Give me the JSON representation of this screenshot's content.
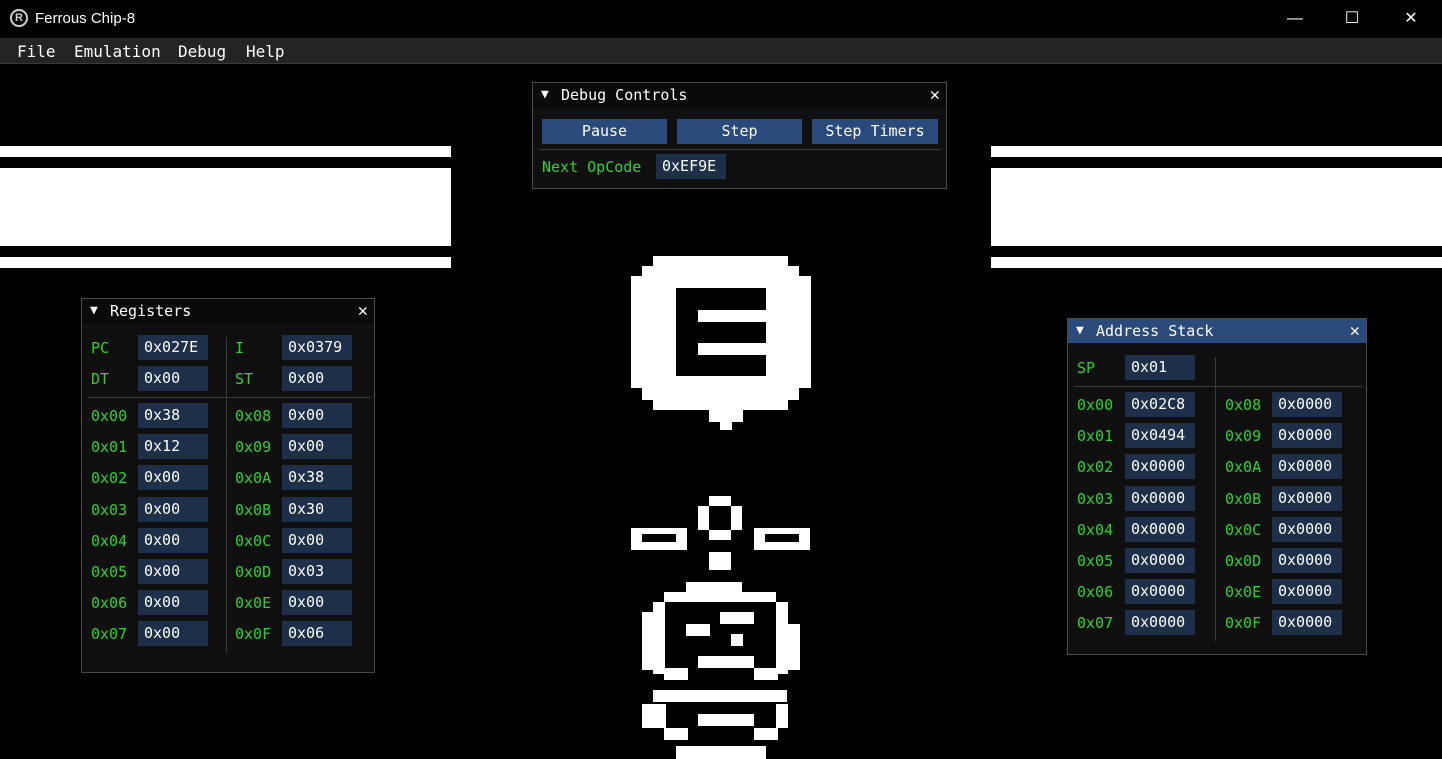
{
  "window": {
    "title": "Ferrous Chip-8",
    "minimize": "—",
    "maximize": "☐",
    "close": "✕"
  },
  "menu": [
    "File",
    "Emulation",
    "Debug",
    "Help"
  ],
  "debug_controls": {
    "title": "Debug Controls",
    "buttons": [
      "Pause",
      "Step",
      "Step Timers"
    ],
    "next_opcode_label": "Next OpCode",
    "next_opcode": "0xEF9E"
  },
  "registers": {
    "title": "Registers",
    "special": [
      {
        "label": "PC",
        "value": "0x027E"
      },
      {
        "label": "I",
        "value": "0x0379"
      },
      {
        "label": "DT",
        "value": "0x00"
      },
      {
        "label": "ST",
        "value": "0x00"
      }
    ],
    "left": [
      {
        "label": "0x00",
        "value": "0x38"
      },
      {
        "label": "0x01",
        "value": "0x12"
      },
      {
        "label": "0x02",
        "value": "0x00"
      },
      {
        "label": "0x03",
        "value": "0x00"
      },
      {
        "label": "0x04",
        "value": "0x00"
      },
      {
        "label": "0x05",
        "value": "0x00"
      },
      {
        "label": "0x06",
        "value": "0x00"
      },
      {
        "label": "0x07",
        "value": "0x00"
      }
    ],
    "right": [
      {
        "label": "0x08",
        "value": "0x00"
      },
      {
        "label": "0x09",
        "value": "0x00"
      },
      {
        "label": "0x0A",
        "value": "0x38"
      },
      {
        "label": "0x0B",
        "value": "0x30"
      },
      {
        "label": "0x0C",
        "value": "0x00"
      },
      {
        "label": "0x0D",
        "value": "0x03"
      },
      {
        "label": "0x0E",
        "value": "0x00"
      },
      {
        "label": "0x0F",
        "value": "0x06"
      }
    ]
  },
  "address_stack": {
    "title": "Address Stack",
    "sp_label": "SP",
    "sp_value": "0x01",
    "left": [
      {
        "label": "0x00",
        "value": "0x02C8"
      },
      {
        "label": "0x01",
        "value": "0x0494"
      },
      {
        "label": "0x02",
        "value": "0x0000"
      },
      {
        "label": "0x03",
        "value": "0x0000"
      },
      {
        "label": "0x04",
        "value": "0x0000"
      },
      {
        "label": "0x05",
        "value": "0x0000"
      },
      {
        "label": "0x06",
        "value": "0x0000"
      },
      {
        "label": "0x07",
        "value": "0x0000"
      }
    ],
    "right": [
      {
        "label": "0x08",
        "value": "0x0000"
      },
      {
        "label": "0x09",
        "value": "0x0000"
      },
      {
        "label": "0x0A",
        "value": "0x0000"
      },
      {
        "label": "0x0B",
        "value": "0x0000"
      },
      {
        "label": "0x0C",
        "value": "0x0000"
      },
      {
        "label": "0x0D",
        "value": "0x0000"
      },
      {
        "label": "0x0E",
        "value": "0x0000"
      },
      {
        "label": "0x0F",
        "value": "0x0000"
      }
    ]
  },
  "icons": {
    "collapse": "triangle-down-icon",
    "close": "close-icon"
  }
}
